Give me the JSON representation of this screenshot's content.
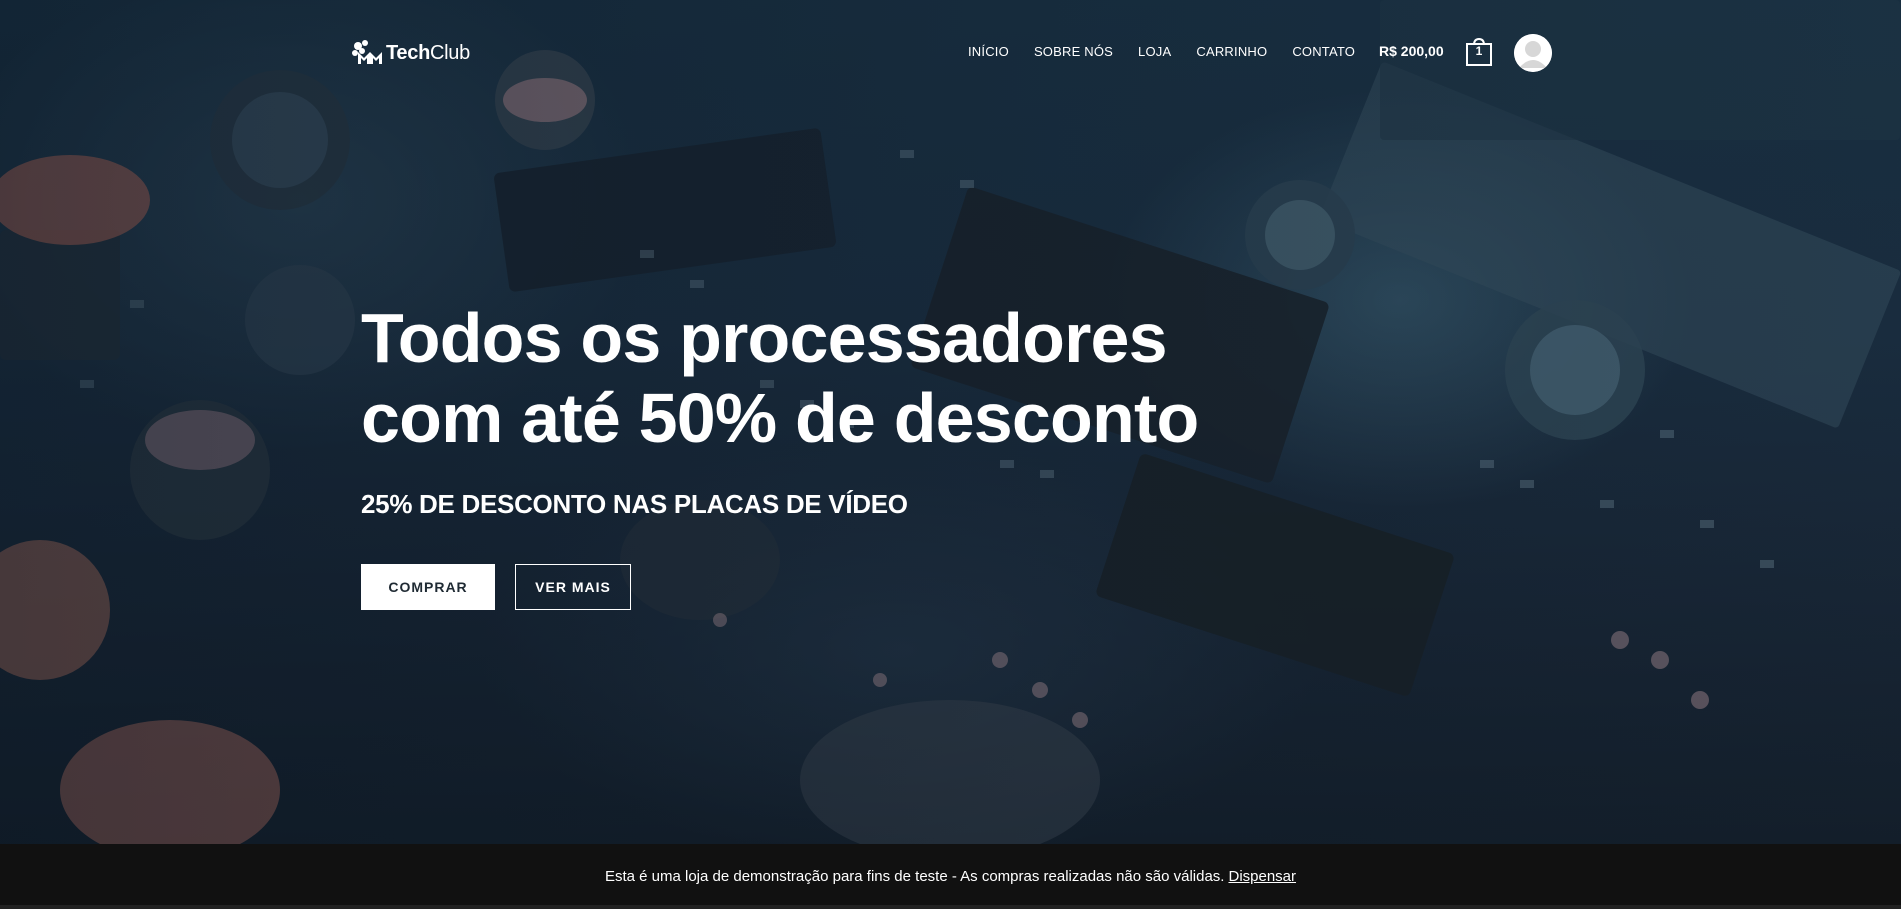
{
  "brand": {
    "logo_bold": "Tech",
    "logo_light": "Club"
  },
  "nav": {
    "items": [
      {
        "label": "INÍCIO"
      },
      {
        "label": "SOBRE NÓS"
      },
      {
        "label": "LOJA"
      },
      {
        "label": "CARRINHO"
      },
      {
        "label": "CONTATO"
      }
    ]
  },
  "cart": {
    "total": "R$ 200,00",
    "count": "1",
    "icon": "shopping-bag-icon"
  },
  "account": {
    "icon": "user-avatar-icon"
  },
  "hero": {
    "title_line1": "Todos os processadores",
    "title_line2": "com até 50% de desconto",
    "subtitle": "25% DE DESCONTO NAS PLACAS DE VÍDEO",
    "primary_button": "COMPRAR",
    "secondary_button": "VER MAIS"
  },
  "notice": {
    "text": "Esta é uma loja de demonstração para fins de teste - As compras realizadas não são válidas.",
    "dismiss_label": "Dispensar"
  },
  "colors": {
    "notice_bar": "#111111",
    "text": "#ffffff",
    "button_primary_bg": "#ffffff",
    "hero_tint": "#1b3346"
  }
}
